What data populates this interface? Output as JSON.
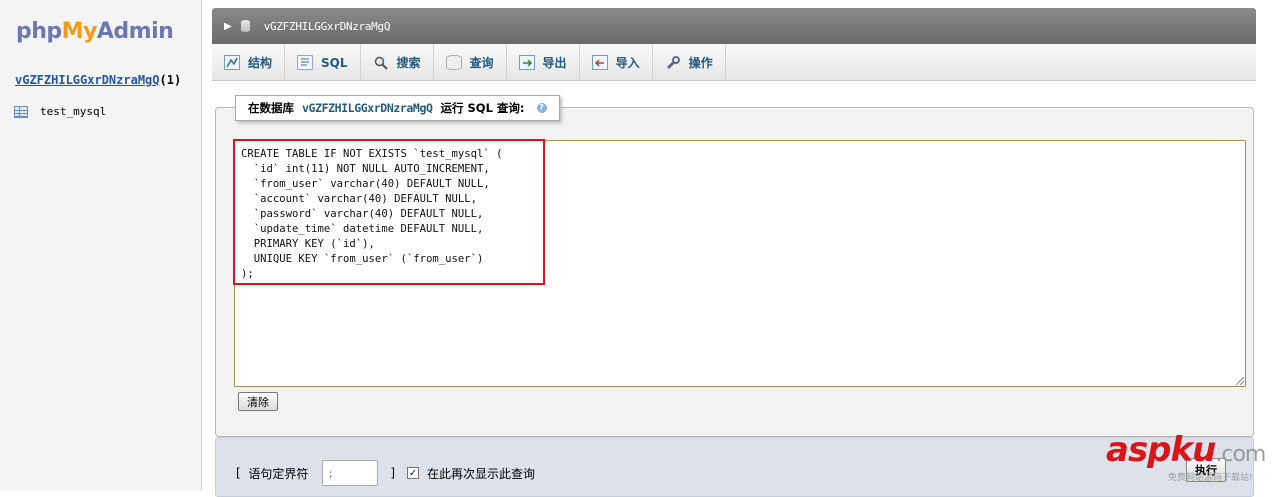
{
  "nav": {
    "logo": {
      "php": "php",
      "my": "My",
      "admin": "Admin"
    },
    "db_name": "vGZFZHILGGxrDNzraMgQ",
    "db_count": "(1)",
    "tables": [
      {
        "label": "test_mysql"
      }
    ]
  },
  "breadcrumb": {
    "db_name": "vGZFZHILGGxrDNzraMgQ"
  },
  "tabs": [
    {
      "label": "结构",
      "icon": "structure-icon"
    },
    {
      "label": "SQL",
      "icon": "sql-icon"
    },
    {
      "label": "搜索",
      "icon": "search-icon"
    },
    {
      "label": "查询",
      "icon": "query-icon"
    },
    {
      "label": "导出",
      "icon": "export-icon"
    },
    {
      "label": "导入",
      "icon": "import-icon"
    },
    {
      "label": "操作",
      "icon": "wrench-icon"
    }
  ],
  "legend": {
    "prefix": "在数据库",
    "db_name": "vGZFZHILGGxrDNzraMgQ",
    "suffix": "运行 SQL 查询:",
    "help": "?"
  },
  "sql_text": "CREATE TABLE IF NOT EXISTS `test_mysql` (\n  `id` int(11) NOT NULL AUTO_INCREMENT,\n  `from_user` varchar(40) DEFAULT NULL,\n  `account` varchar(40) DEFAULT NULL,\n  `password` varchar(40) DEFAULT NULL,\n  `update_time` datetime DEFAULT NULL,\n  PRIMARY KEY (`id`),\n  UNIQUE KEY `from_user` (`from_user`)\n);",
  "clear_button": "清除",
  "delimiter": {
    "open_bracket": "[",
    "label": "语句定界符",
    "value": ";",
    "close_bracket": "]"
  },
  "show_again": {
    "checked": true,
    "label": "在此再次显示此查询"
  },
  "go_button": "执行",
  "watermark": {
    "brand_red": "asp",
    "brand_red2": "ku",
    "domain": ".com",
    "sub": "免费网站源码下载站!"
  },
  "colors": {
    "link": "#235a81",
    "highlight_border": "#e0131c",
    "watermark_red": "#d9141b"
  }
}
